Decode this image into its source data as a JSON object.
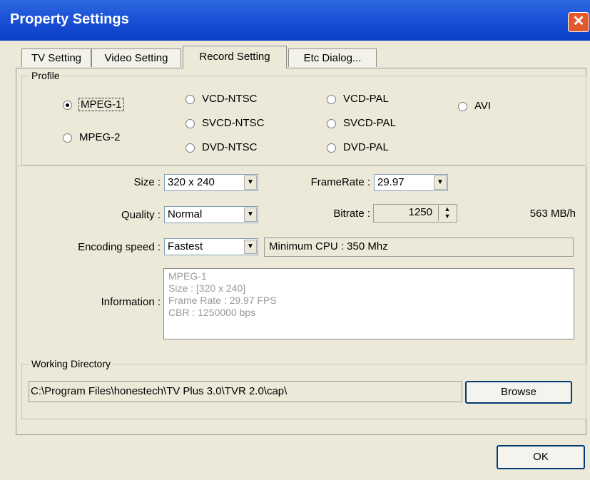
{
  "window": {
    "title": "Property Settings",
    "close_glyph": "✕"
  },
  "tabs": [
    {
      "label": "TV Setting",
      "active": false
    },
    {
      "label": "Video Setting",
      "active": false
    },
    {
      "label": "Record Setting",
      "active": true
    },
    {
      "label": "Etc Dialog...",
      "active": false
    }
  ],
  "profile": {
    "legend": "Profile",
    "options": {
      "mpeg1": "MPEG-1",
      "mpeg2": "MPEG-2",
      "vcd_ntsc": "VCD-NTSC",
      "svcd_ntsc": "SVCD-NTSC",
      "dvd_ntsc": "DVD-NTSC",
      "vcd_pal": "VCD-PAL",
      "svcd_pal": "SVCD-PAL",
      "dvd_pal": "DVD-PAL",
      "avi": "AVI"
    },
    "selected": "MPEG-1"
  },
  "settings": {
    "size_label": "Size :",
    "size_value": "320 x 240",
    "framerate_label": "FrameRate :",
    "framerate_value": "29.97",
    "quality_label": "Quality :",
    "quality_value": "Normal",
    "bitrate_label": "Bitrate :",
    "bitrate_value": "1250",
    "filesize_rate": "563 MB/h",
    "encoding_label": "Encoding speed :",
    "encoding_value": "Fastest",
    "min_cpu": "Minimum CPU : 350 Mhz",
    "information_label": "Information :",
    "information_lines": [
      "MPEG-1",
      "Size : [320 x 240]",
      "Frame Rate : 29.97 FPS",
      "CBR : 1250000 bps"
    ]
  },
  "working_directory": {
    "legend": "Working Directory",
    "path": "C:\\Program Files\\honestech\\TV Plus 3.0\\TVR 2.0\\cap\\",
    "browse_label": "Browse"
  },
  "footer": {
    "ok_label": "OK"
  },
  "colors": {
    "titlebar": "#0a3fc6",
    "dialog_bg": "#ece9d8",
    "close": "#e05a2e"
  }
}
